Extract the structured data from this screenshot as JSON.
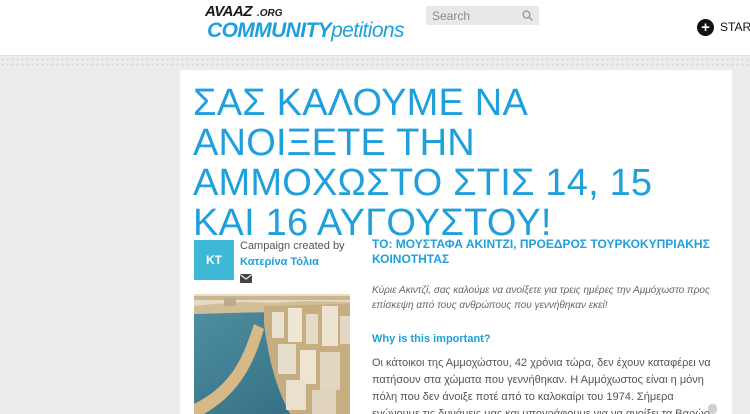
{
  "header": {
    "logo": {
      "avaaz": "AVAAZ",
      "org": ".ORG",
      "community": "COMMUNITY",
      "petitions": "petitions"
    },
    "search": {
      "placeholder": "Search",
      "value": ""
    },
    "start": {
      "label": "STAR"
    }
  },
  "petition": {
    "title": "ΣΑΣ ΚΑΛΟΥΜΕ ΝΑ ΑΝΟΙΞΕΤΕ ΤΗΝ ΑΜΜΟΧΩΣΤΟ ΣΤΙΣ 14, 15 ΚΑΙ 16 ΑΥΓΟΥΣΤΟΥ!",
    "creator": {
      "initials": "KT",
      "created_label": "Campaign created by",
      "name": "Κατερίνα Τόλια"
    },
    "to": "TO: ΜΟΥΣΤΑΦΑ ΑΚΙΝΤΖΙ, ΠΡΟΕΔΡΟΣ ΤΟΥΡΚΟΚΥΠΡΙΑΚΗΣ ΚΟΙΝΟΤΗΤΑΣ",
    "intro": "Κύριε Ακιντζί, σας καλούμε να ανοίξετε για τρεις ημέρες την Αμμόχωστο προς επίσκεψη από τους ανθρώπους που γεννήθηκαν εκεί!",
    "why_heading": "Why is this important?",
    "body": "Οι κάτοικοι της Αμμοχώστου, 42 χρόνια τώρα, δεν έχουν καταφέρει να πατήσουν στα χώματα που γεννήθηκαν. Η Αμμόχωστος είναι η μόνη πόλη που δεν άνοιξε ποτέ από το καλοκαίρι του 1974. Σήμερα ενώνουμε τις δυνάμεις μας και υπογράφουμε για να ανοίξει τα Βαρώσι"
  },
  "colors": {
    "accent": "#1fa0dc",
    "avatar_bg": "#3fb8d6",
    "page_bg": "#ececec"
  }
}
